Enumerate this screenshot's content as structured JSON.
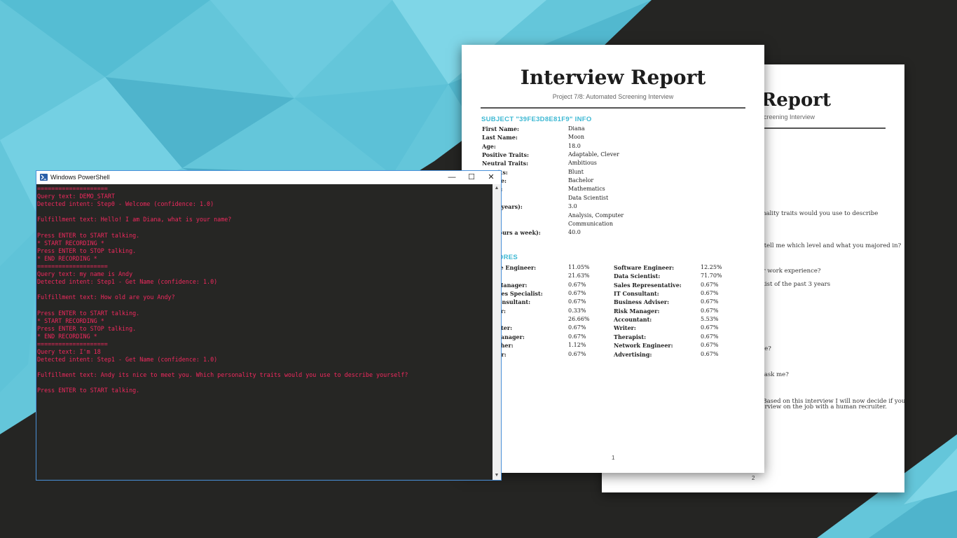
{
  "colors": {
    "accent_cyan": "#3db8d3",
    "terminal_text": "#f0295e",
    "terminal_bg": "#262624",
    "dark_bg": "#252523"
  },
  "page2": {
    "title": "Report",
    "subtitle": "creening Interview",
    "lines": [
      "onality traits would you use to describe",
      "t",
      "a tell me which level and what you majored in?",
      "ur work experience?",
      "ntist of the past 3 years",
      "ble?",
      "o ask me?",
      ". Based on this interview I will now decide if you",
      "terview on the job with a human recruiter."
    ],
    "page_number": "2"
  },
  "page1": {
    "title": "Interview Report",
    "subtitle": "Project 7/8: Automated Screening Interview",
    "info_heading": "SUBJECT \"39FE3D8E81F9\" INFO",
    "info": [
      {
        "k": "First Name:",
        "v": "Diana"
      },
      {
        "k": "Last Name:",
        "v": "Moon"
      },
      {
        "k": "Age:",
        "v": "18.0"
      },
      {
        "k": "Positive Traits:",
        "v": "Adaptable, Clever"
      },
      {
        "k": "Neutral Traits:",
        "v": "Ambitious"
      },
      {
        "k": "e Traits:",
        "v": "Blunt"
      },
      {
        "k": "Degree:",
        "v": "Bachelor"
      },
      {
        "k": "Major:",
        "v": "Mathematics"
      },
      {
        "k": "n:",
        "v": "Data Scientist"
      },
      {
        "k": "ence (years):",
        "v": "3.0"
      },
      {
        "k": "hs:",
        "v": "Analysis, Computer"
      },
      {
        "k": "sses:",
        "v": "Communication"
      },
      {
        "k": "ity (hours a week):",
        "v": "40.0"
      }
    ],
    "scores_heading": "H SCORES",
    "scores": [
      {
        "n1": "Software Engineer:",
        "s1": "11.05%",
        "n2": "Software Engineer:",
        "s2": "12.25%"
      },
      {
        "n1": "alyst:",
        "s1": "21.63%",
        "n2": "Data Scientist:",
        "s2": "71.70%"
      },
      {
        "n1": "Media Manager:",
        "s1": "0.67%",
        "n2": "Sales Representative:",
        "s2": "0.67%"
      },
      {
        "n1": "Resources Specialist:",
        "s1": "0.67%",
        "n2": "IT Consultant:",
        "s2": "0.67%"
      },
      {
        "n1": "ment Consultant:",
        "s1": "0.67%",
        "n2": "Business Adviser:",
        "s2": "0.67%"
      },
      {
        "n1": "Manager:",
        "s1": "0.33%",
        "n2": "Risk Manager:",
        "s2": "0.67%"
      },
      {
        "n1": "rian:",
        "s1": "26.66%",
        "n2": "Accountant:",
        "s2": "5.53%"
      },
      {
        "n1": "Copywriter:",
        "s1": "0.67%",
        "n2": "Writer:",
        "s2": "0.67%"
      },
      {
        "n1": "ntent Manager:",
        "s1": "0.67%",
        "n2": "Therapist:",
        "s2": "0.67%"
      },
      {
        "n1": "Researcher:",
        "s1": "1.12%",
        "n2": "Network Engineer:",
        "s2": "0.67%"
      },
      {
        "n1": "Engineer:",
        "s1": "0.67%",
        "n2": "Advertising:",
        "s2": "0.67%"
      }
    ],
    "page_number": "1"
  },
  "powershell": {
    "title": "Windows PowerShell",
    "minimize": "—",
    "maximize": "☐",
    "close": "✕",
    "scroll_up": "▲",
    "scroll_down": "▼",
    "lines": [
      "====================",
      "Query text: DEMO_START",
      "Detected intent: Step0 - Welcome (confidence: 1.0)",
      "",
      "Fulfillment text: Hello! I am Diana, what is your name?",
      "",
      "Press ENTER to START talking.",
      "* START RECORDING *",
      "Press ENTER to STOP talking.",
      "* END RECORDING *",
      "====================",
      "Query text: my name is Andy",
      "Detected intent: Step1 - Get Name (confidence: 1.0)",
      "",
      "Fulfillment text: How old are you Andy?",
      "",
      "Press ENTER to START talking.",
      "* START RECORDING *",
      "Press ENTER to STOP talking.",
      "* END RECORDING *",
      "====================",
      "Query text: I'm 18",
      "Detected intent: Step1 - Get Name (confidence: 1.0)",
      "",
      "Fulfillment text: Andy its nice to meet you. Which personality traits would you use to describe yourself?",
      "",
      "Press ENTER to START talking."
    ]
  }
}
